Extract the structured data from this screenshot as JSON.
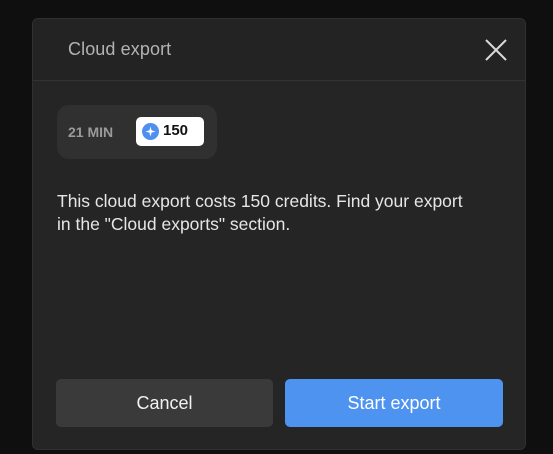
{
  "dialog": {
    "title": "Cloud export",
    "close_icon": "close-icon"
  },
  "summary": {
    "duration": "21 MIN",
    "credits": "150",
    "credit_icon": "credit-coin-icon"
  },
  "description": "This cloud export costs 150 credits. Find your export in the \"Cloud exports\" section.",
  "buttons": {
    "cancel": "Cancel",
    "start": "Start export"
  },
  "colors": {
    "accent": "#4f93f0",
    "dialog_bg": "#252525"
  }
}
